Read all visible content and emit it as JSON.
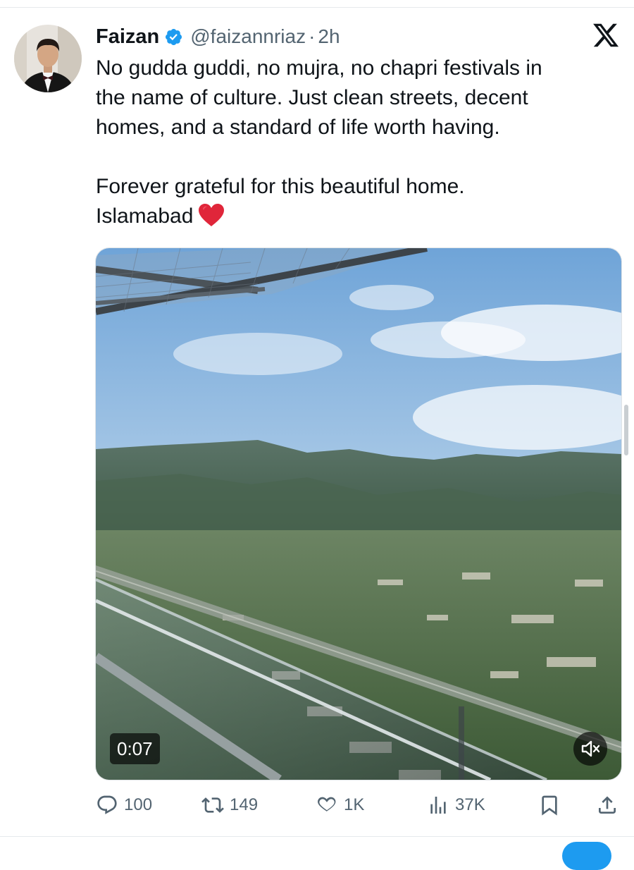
{
  "tweet": {
    "author_name": "Faizan",
    "handle": "@faizannriaz",
    "separator": "·",
    "time": "2h",
    "text_lines": [
      "No gudda guddi, no mujra, no chapri festivals in",
      "the name of culture. Just clean streets, decent",
      "homes, and a standard of life worth having."
    ],
    "text_line2": "Forever grateful for this beautiful home.",
    "text_line3": "Islamabad",
    "emoji": "heart-emoji",
    "verified_color": "#1d9bf0"
  },
  "media": {
    "type": "video",
    "duration": "0:07",
    "muted": true
  },
  "actions": {
    "replies": "100",
    "reposts": "149",
    "likes": "1K",
    "views": "37K"
  },
  "icons": [
    "x-logo-icon",
    "verified-badge-icon",
    "reply-icon",
    "repost-icon",
    "like-icon",
    "views-icon",
    "bookmark-icon",
    "share-icon",
    "mute-icon"
  ],
  "colors": {
    "text": "#0f1419",
    "secondary": "#536471",
    "accent": "#1d9bf0",
    "heart": "#e0263a"
  }
}
